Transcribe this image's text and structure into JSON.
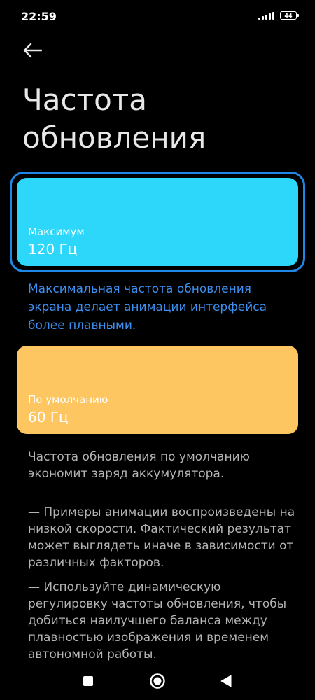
{
  "status_bar": {
    "time": "22:59",
    "battery": "44"
  },
  "header": {
    "title": "Частота обновления"
  },
  "options": [
    {
      "label": "Максимум",
      "value": "120 Гц",
      "color": "#2dd7f9",
      "selected": true,
      "description": "Максимальная частота обновления экрана делает анимации интерфейса более плавными."
    },
    {
      "label": "По умолчанию",
      "value": "60 Гц",
      "color": "#fdc661",
      "selected": false,
      "description": "Частота обновления по умолчанию экономит заряд аккумулятора."
    }
  ],
  "notes": [
    "— Примеры анимации воспроизведены на низкой скорости. Фактический результат может выглядеть иначе в зависимости от различных факторов.",
    "— Используйте динамическую регулировку частоты обновления, чтобы добиться наилучшего баланса между плавностью изображения и временем автономной работы."
  ],
  "colors": {
    "background": "#000000",
    "selection_border": "#1f87e6",
    "accent_text": "#3d8ff0",
    "secondary_text": "#b4b4b4"
  },
  "icons": {
    "back": "arrow-left-icon",
    "signal": "signal-icon",
    "battery": "battery-icon",
    "nav_recents": "square-icon",
    "nav_home": "circle-icon",
    "nav_back": "triangle-back-icon"
  }
}
